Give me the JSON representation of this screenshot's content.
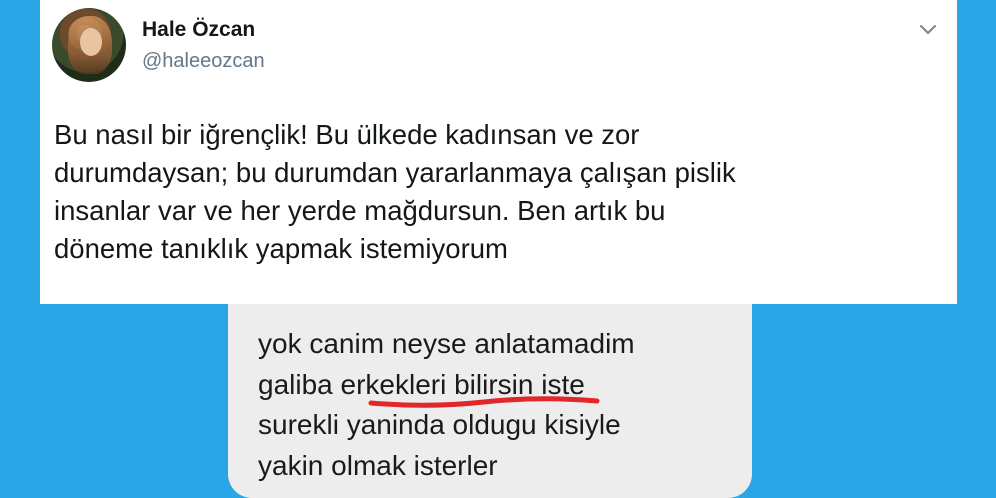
{
  "tweet": {
    "display_name": "Hale Özcan",
    "handle": "@haleeozcan",
    "lines": [
      "Bu nasıl bir iğrençlik! Bu ülkede kadınsan ve zor",
      "durumdaysan; bu durumdan yararlanmaya çalışan pislik",
      "insanlar var ve her yerde mağdursun. Ben artık bu",
      "döneme tanıklık yapmak istemiyorum"
    ],
    "menu_icon": "chevron-down-icon",
    "avatar_icon": "avatar"
  },
  "message": {
    "lines": [
      "yok canim  neyse anlatamadim",
      "galiba erkekleri bilirsin iste",
      "surekli yaninda oldugu kisiyle",
      "yakin olmak isterler"
    ],
    "highlighted_phrase": "erkekleri bilirsin",
    "highlight_color": "#e0282a"
  },
  "colors": {
    "background": "#2aa6e6",
    "card": "#ffffff",
    "bubble": "#ededed"
  }
}
